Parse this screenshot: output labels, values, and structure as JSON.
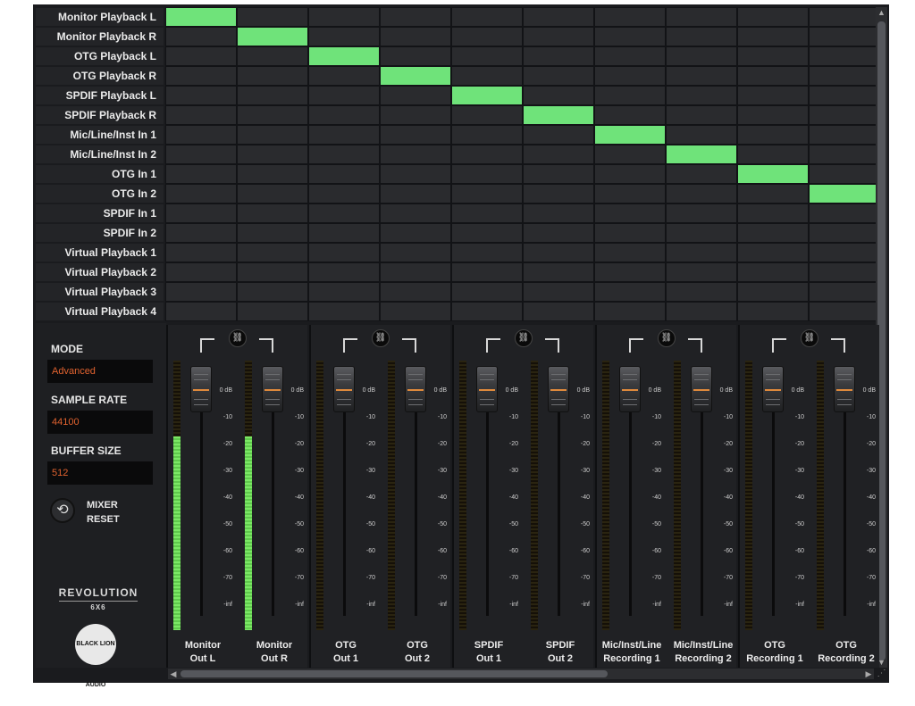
{
  "routing": {
    "rows": [
      "Monitor Playback L",
      "Monitor Playback R",
      "OTG Playback L",
      "OTG Playback R",
      "SPDIF Playback L",
      "SPDIF Playback R",
      "Mic/Line/Inst In 1",
      "Mic/Line/Inst In 2",
      "OTG In 1",
      "OTG In 2",
      "SPDIF In 1",
      "SPDIF In 2",
      "Virtual Playback 1",
      "Virtual Playback 2",
      "Virtual Playback 3",
      "Virtual Playback 4"
    ],
    "active_routes": [
      [
        0,
        0
      ],
      [
        1,
        1
      ],
      [
        2,
        2
      ],
      [
        3,
        3
      ],
      [
        4,
        4
      ],
      [
        5,
        5
      ],
      [
        6,
        6
      ],
      [
        7,
        7
      ],
      [
        8,
        8
      ],
      [
        9,
        9
      ]
    ]
  },
  "settings": {
    "mode_label": "MODE",
    "mode_value": "Advanced",
    "sample_rate_label": "SAMPLE RATE",
    "sample_rate_value": "44100",
    "buffer_size_label": "BUFFER SIZE",
    "buffer_size_value": "512",
    "reset_line1": "MIXER",
    "reset_line2": "RESET"
  },
  "branding": {
    "product_name": "REVOLUTION",
    "product_model": "6X6",
    "company": "BLACK LION AUDIO"
  },
  "fader_scale": [
    "0 dB",
    "-10",
    "-20",
    "-30",
    "-40",
    "-50",
    "-60",
    "-70",
    "-inf"
  ],
  "channels": [
    {
      "line1": "Monitor",
      "line2": "Out L",
      "meter_level": 0.72,
      "fader_db": 0
    },
    {
      "line1": "Monitor",
      "line2": "Out R",
      "meter_level": 0.72,
      "fader_db": 0
    },
    {
      "line1": "OTG",
      "line2": "Out 1",
      "meter_level": 0,
      "fader_db": 0
    },
    {
      "line1": "OTG",
      "line2": "Out 2",
      "meter_level": 0,
      "fader_db": 0
    },
    {
      "line1": "SPDIF",
      "line2": "Out 1",
      "meter_level": 0,
      "fader_db": 0
    },
    {
      "line1": "SPDIF",
      "line2": "Out 2",
      "meter_level": 0,
      "fader_db": 0
    },
    {
      "line1": "Mic/Inst/Line",
      "line2": "Recording 1",
      "meter_level": 0,
      "fader_db": 0
    },
    {
      "line1": "Mic/Inst/Line",
      "line2": "Recording 2",
      "meter_level": 0,
      "fader_db": 0
    },
    {
      "line1": "OTG",
      "line2": "Recording 1",
      "meter_level": 0,
      "fader_db": 0
    },
    {
      "line1": "OTG",
      "line2": "Recording 2",
      "meter_level": 0,
      "fader_db": 0
    }
  ],
  "colors": {
    "route_active": "#6fe37a",
    "meter": "#6fdc5a",
    "value_text": "#e0622f"
  },
  "icons": {
    "link": "link-icon",
    "reset": "reset-icon"
  }
}
